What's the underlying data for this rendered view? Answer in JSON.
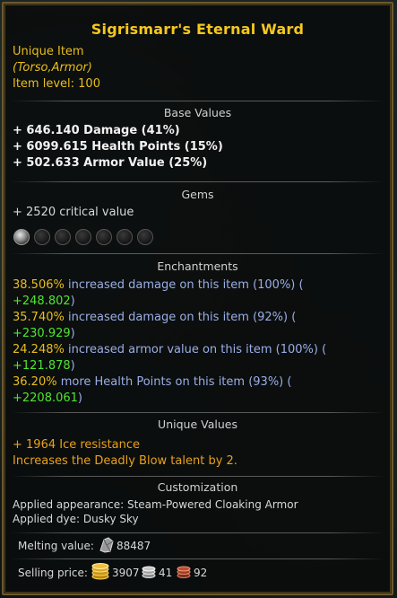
{
  "item": {
    "name": "Sigrismarr's Eternal Ward",
    "rarity": "Unique Item",
    "type": "(Torso,Armor)",
    "level": "Item  level:  100"
  },
  "base": {
    "title": "Base Values",
    "lines": [
      "+  646.140  Damage  (41%)",
      "+  6099.615  Health  Points  (15%)",
      "+  502.633  Armor  Value  (25%)"
    ]
  },
  "gems": {
    "title": "Gems",
    "line": "+  2520  critical  value",
    "sockets_filled": 1,
    "sockets_total": 7
  },
  "enchantments": {
    "title": "Enchantments",
    "items": [
      {
        "pct": "38.506%",
        "text": " increased  damage  on  this  item  (100%)  (",
        "bonus": "+248.802",
        "close": ")"
      },
      {
        "pct": "35.740%",
        "text": " increased  damage  on  this  item  (92%)  (",
        "bonus": "+230.929",
        "close": ")"
      },
      {
        "pct": "24.248%",
        "text": " increased  armor  value  on  this  item  (100%)  (",
        "bonus": "+121.878",
        "close": ")"
      },
      {
        "pct": "36.20%",
        "text": " more  Health  Points  on  this  item  (93%)  (",
        "bonus": "+2208.061",
        "close": ")"
      }
    ]
  },
  "unique": {
    "title": "Unique Values",
    "lines": [
      "+  1964  Ice  resistance",
      "Increases  the  Deadly  Blow  talent  by  2."
    ]
  },
  "custom": {
    "title": "Customization",
    "appearance": "Applied  appearance:  Steam-Powered  Cloaking  Armor",
    "dye": "Applied  dye:  Dusky  Sky"
  },
  "melting": {
    "label": "Melting  value:",
    "value": "88487"
  },
  "selling": {
    "label": "Selling  price:",
    "gold": "3907",
    "silver": "41",
    "copper": "92"
  },
  "colors": {
    "title": "#f5c81e",
    "unique": "#e8be1c",
    "enchant_pct": "#e8be1c",
    "enchant_text": "#9aaee6",
    "enchant_bonus": "#4ee62e",
    "border": "#6b5a2e"
  },
  "icons": [
    "shard-icon",
    "gold-coin-icon",
    "silver-coin-icon",
    "copper-coin-icon",
    "gem-socket-icon"
  ]
}
